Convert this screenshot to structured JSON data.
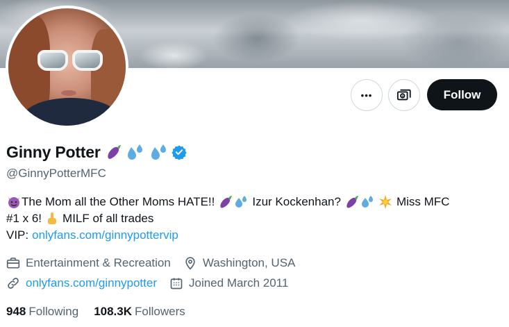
{
  "profile": {
    "display_name": "Ginny Potter",
    "handle": "@GinnyPotterMFC",
    "verified": true
  },
  "actions": {
    "more_label": "•••",
    "follow_label": "Follow"
  },
  "bio": {
    "line1_a": "The Mom all the Other Moms HATE!!",
    "line1_b": "Izur Kockenhan?",
    "line1_c": "Miss MFC",
    "line2_a": "#1 x 6!",
    "line2_b": "MILF of all trades",
    "line3_prefix": "VIP:",
    "line3_link": "onlyfans.com/ginnypottervip"
  },
  "meta": {
    "category": "Entertainment & Recreation",
    "location": "Washington, USA",
    "website": "onlyfans.com/ginnypotter",
    "joined": "Joined March 2011"
  },
  "counts": {
    "following_count": "948",
    "following_label": "Following",
    "followers_count": "108.3K",
    "followers_label": "Followers"
  },
  "colors": {
    "link": "#1d9bf0",
    "secondary_text": "#536471",
    "follow_button_bg": "#0f1419",
    "verified_badge": "#1d9bf0"
  },
  "icons": [
    "more-icon",
    "subscribe-icon",
    "verified-badge-icon",
    "briefcase-icon",
    "location-pin-icon",
    "link-icon",
    "calendar-icon",
    "devil-emoji",
    "eggplant-emoji",
    "sweat-droplets-emoji",
    "star-emoji",
    "middle-finger-emoji"
  ]
}
